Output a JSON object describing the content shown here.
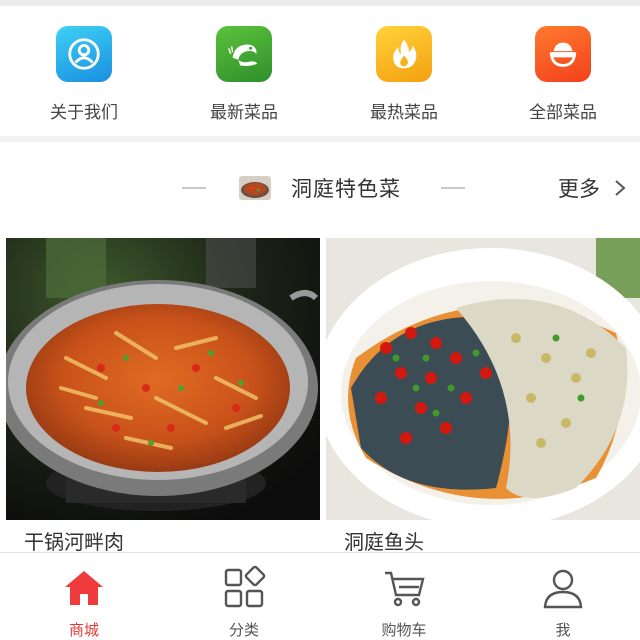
{
  "quick_nav": [
    {
      "label": "关于我们",
      "icon": "profile-icon",
      "color": "#1ea7e6"
    },
    {
      "label": "最新菜品",
      "icon": "shrimp-icon",
      "color": "#3aa534"
    },
    {
      "label": "最热菜品",
      "icon": "flame-icon",
      "color": "#f7b21a"
    },
    {
      "label": "全部菜品",
      "icon": "rice-bowl-icon",
      "color": "#ff5a1f"
    }
  ],
  "section": {
    "title": "洞庭特色菜",
    "more_label": "更多",
    "thumb_icon": "dish-thumbnail"
  },
  "products": [
    {
      "name": "干锅河畔肉",
      "image": "dry-pot-dish-image"
    },
    {
      "name": "洞庭鱼头",
      "image": "fish-head-dish-image"
    }
  ],
  "tabbar": {
    "active_color": "#e53935",
    "items": [
      {
        "label": "商城",
        "icon": "home-icon",
        "active": true
      },
      {
        "label": "分类",
        "icon": "category-grid-icon",
        "active": false
      },
      {
        "label": "购物车",
        "icon": "cart-icon",
        "active": false
      },
      {
        "label": "我",
        "icon": "user-icon",
        "active": false
      }
    ]
  }
}
